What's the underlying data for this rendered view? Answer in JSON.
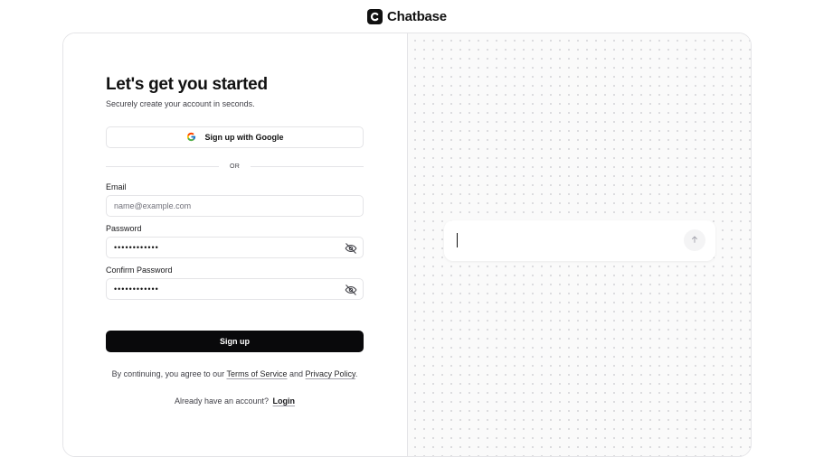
{
  "brand": {
    "name": "Chatbase"
  },
  "signup": {
    "heading": "Let's get you started",
    "subtitle": "Securely create your account in seconds.",
    "google_button": "Sign up with Google",
    "divider": "OR",
    "email_label": "Email",
    "email_placeholder": "name@example.com",
    "password_label": "Password",
    "password_masked": "••••••••••••",
    "confirm_label": "Confirm Password",
    "confirm_masked": "••••••••••••",
    "submit": "Sign up",
    "terms_prefix": "By continuing, you agree to our ",
    "terms_link": "Terms of Service",
    "terms_and": " and ",
    "privacy_link": "Privacy Policy",
    "terms_suffix": ".",
    "login_prompt": "Already have an account?",
    "login_link": "Login"
  },
  "icons": {
    "logo": "chatbase-logo-icon",
    "google": "google-icon",
    "password_toggle": "eye-off-icon",
    "send": "arrow-up-icon"
  },
  "colors": {
    "primary_button": "#09090b",
    "border": "#e4e4e7",
    "dot_grid": "#d4d4d8"
  }
}
